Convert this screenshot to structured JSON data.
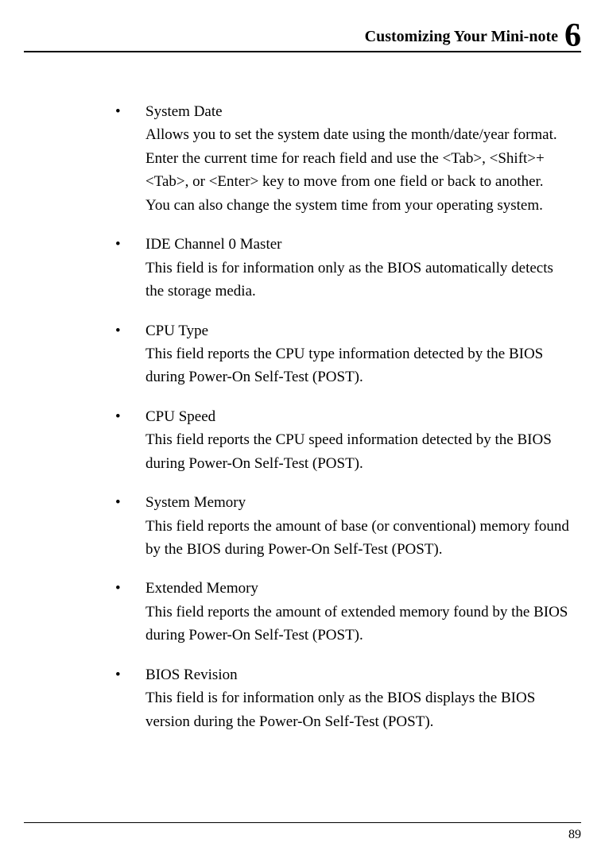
{
  "header": {
    "title": "Customizing Your Mini-note",
    "chapter": "6"
  },
  "items": [
    {
      "title": "System Date",
      "body": "Allows you to set the system date using the month/date/year format. Enter the current time for reach field and use the <Tab>, <Shift>+<Tab>, or <Enter> key to move from one field or back to another.",
      "body2": "You can also change the system time from your operating system."
    },
    {
      "title": "IDE Channel 0 Master",
      "body": "This field is for information only as the BIOS automatically detects the storage media."
    },
    {
      "title": "CPU Type",
      "body": "This field reports the CPU type information detected by the BIOS during Power-On Self-Test (POST)."
    },
    {
      "title": "CPU Speed",
      "body": "This field reports the CPU speed information detected by the BIOS during Power-On Self-Test (POST)."
    },
    {
      "title": "System Memory",
      "body": "This field reports the amount of base (or conventional) memory found by the BIOS during Power-On Self-Test (POST)."
    },
    {
      "title": "Extended Memory",
      "body": "This field reports the amount of extended memory found by the BIOS during Power-On Self-Test (POST)."
    },
    {
      "title": "BIOS Revision",
      "body": "This field is for information only as the BIOS displays the BIOS version during the Power-On Self-Test (POST)."
    }
  ],
  "footer": {
    "page_number": "89"
  },
  "bullet_char": "•"
}
